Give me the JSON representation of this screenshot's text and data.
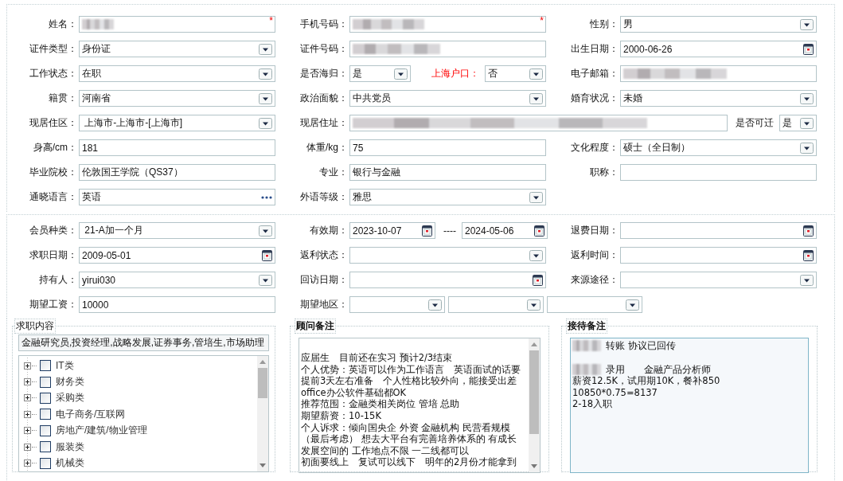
{
  "sections": [
    {
      "rows": [
        [
          {
            "label": "姓名：",
            "items": [
              {
                "kind": "masked",
                "required_mark": "*"
              }
            ]
          },
          {
            "label": "手机号码：",
            "items": [
              {
                "kind": "masked",
                "required_mark": "*"
              }
            ]
          },
          {
            "label": "性别：",
            "items": [
              {
                "kind": "select",
                "value": "男"
              }
            ]
          }
        ],
        [
          {
            "label": "证件类型：",
            "items": [
              {
                "kind": "select",
                "value": "身份证"
              }
            ]
          },
          {
            "label": "证件号码：",
            "items": [
              {
                "kind": "masked"
              }
            ]
          },
          {
            "label": "出生日期：",
            "items": [
              {
                "kind": "date",
                "value": "2000-06-26"
              }
            ]
          }
        ],
        [
          {
            "label": "工作状态：",
            "items": [
              {
                "kind": "select",
                "value": "在职"
              }
            ]
          },
          {
            "label": "是否海归：",
            "items": [
              {
                "kind": "select",
                "value": "是"
              },
              {
                "kind": "label",
                "text": "上海户口：",
                "emphasis": true
              },
              {
                "kind": "select",
                "value": "否"
              }
            ]
          },
          {
            "label": "电子邮箱：",
            "items": [
              {
                "kind": "masked"
              }
            ]
          }
        ],
        [
          {
            "label": "籍贯：",
            "items": [
              {
                "kind": "select",
                "value": "河南省"
              }
            ]
          },
          {
            "label": "政治面貌：",
            "items": [
              {
                "kind": "select",
                "value": "中共党员"
              }
            ]
          },
          {
            "label": "婚育状况：",
            "items": [
              {
                "kind": "select",
                "value": "未婚"
              }
            ]
          }
        ],
        [
          {
            "label": "现居住区：",
            "items": [
              {
                "kind": "select",
                "value": " 上海市-上海市-[上海市]"
              }
            ]
          },
          {
            "label": "现居住址：",
            "items": [
              {
                "kind": "masked"
              },
              {
                "kind": "label",
                "text": "是否可迁",
                "emphasis": false
              },
              {
                "kind": "select",
                "value": "是"
              }
            ]
          }
        ],
        [
          {
            "label": "身高/cm：",
            "items": [
              {
                "kind": "text",
                "value": "181"
              }
            ]
          },
          {
            "label": "体重/kg：",
            "items": [
              {
                "kind": "text",
                "value": "75"
              }
            ]
          },
          {
            "label": "文化程度：",
            "items": [
              {
                "kind": "select",
                "value": "硕士（全日制）"
              }
            ]
          }
        ],
        [
          {
            "label": "毕业院校：",
            "items": [
              {
                "kind": "text",
                "value": "伦敦国王学院（QS37）"
              }
            ]
          },
          {
            "label": "专业：",
            "items": [
              {
                "kind": "text",
                "value": "银行与金融"
              }
            ]
          },
          {
            "label": "职称：",
            "items": [
              {
                "kind": "text"
              }
            ]
          }
        ],
        [
          {
            "label": "通晓语言：",
            "items": [
              {
                "kind": "more",
                "value": "英语"
              }
            ]
          },
          {
            "label": "外语等级：",
            "items": [
              {
                "kind": "select",
                "value": "雅思"
              }
            ]
          }
        ]
      ]
    },
    {
      "rows": [
        [
          {
            "label": "会员种类：",
            "items": [
              {
                "kind": "select",
                "value": " 21-A加一个月"
              }
            ]
          },
          {
            "label": "有效期：",
            "items": [
              {
                "kind": "date",
                "value": "2023-10-07"
              },
              {
                "kind": "label",
                "text": "----",
                "emphasis": false
              },
              {
                "kind": "date",
                "value": "2024-05-06"
              }
            ]
          },
          {
            "label": "退费日期：",
            "items": [
              {
                "kind": "date"
              }
            ]
          }
        ],
        [
          {
            "label": "求职日期：",
            "items": [
              {
                "kind": "date",
                "value": "2009-05-01"
              }
            ]
          },
          {
            "label": "返利状态：",
            "items": [
              {
                "kind": "select"
              }
            ]
          },
          {
            "label": "返利时间：",
            "items": [
              {
                "kind": "date"
              }
            ]
          }
        ],
        [
          {
            "label": "持有人：",
            "items": [
              {
                "kind": "select",
                "value": "yirui030"
              }
            ]
          },
          {
            "label": "回访日期：",
            "items": [
              {
                "kind": "date"
              }
            ]
          },
          {
            "label": "来源途径：",
            "items": [
              {
                "kind": "select"
              }
            ]
          }
        ],
        [
          {
            "label": "期望工资：",
            "items": [
              {
                "kind": "text",
                "value": "10000"
              }
            ]
          },
          {
            "label": "期望地区：",
            "items": [
              {
                "kind": "select"
              },
              {
                "kind": "select"
              },
              {
                "kind": "select"
              }
            ]
          }
        ]
      ]
    }
  ],
  "panels": [
    {
      "kind": "tree",
      "title": "求职内容",
      "summary": "金融研究员,投资经理,战略发展,证券事务,管培生,市场助理",
      "scrollable": true,
      "items": [
        {
          "label": "IT类",
          "checked": false,
          "expanded": false
        },
        {
          "label": "财务类",
          "checked": false,
          "expanded": false
        },
        {
          "label": "采购类",
          "checked": false,
          "expanded": false
        },
        {
          "label": "电子商务/互联网",
          "checked": false,
          "expanded": false
        },
        {
          "label": "房地产/建筑/物业管理",
          "checked": false,
          "expanded": false
        },
        {
          "label": "服装类",
          "checked": false,
          "expanded": false
        },
        {
          "label": "机械类",
          "checked": false,
          "expanded": false
        }
      ]
    },
    {
      "kind": "note",
      "title": "顾问备注",
      "focused": false,
      "scrollable": true,
      "lines": [
        {
          "text": "应届生　目前还在实习 预计2/3结束",
          "spaced": true
        },
        {
          "text": "个人优势：英语可以作为工作语言　英语面试的话要"
        },
        {
          "text": "提前3天左右准备　个人性格比较外向，能接受出差"
        },
        {
          "text": "office办公软件基础都OK"
        },
        {
          "text": "推荐范围：金融类相关岗位 管培 总助"
        },
        {
          "text": "期望薪资：10-15K"
        },
        {
          "text": "个人诉求：倾向国央企 外资 金融机构 民营看规模"
        },
        {
          "text": "（最后考虑） 想去大平台有完善培养体系的 有成长"
        },
        {
          "text": "发展空间的 工作地点不限 一二线都可以"
        },
        {
          "text": "初面要线上　复试可以线下　明年的2月份才能拿到"
        }
      ]
    },
    {
      "kind": "note",
      "title": "接待备注",
      "focused": true,
      "lines": [
        {
          "text": "转账 协议已回传",
          "masked": true
        },
        {
          "text": "录用　　金融产品分析师",
          "masked": true,
          "spaced": true
        },
        {
          "text": "薪资12.5K，试用期10K，餐补850"
        },
        {
          "text": "10850*0.75=8137"
        },
        {
          "text": "2-18入职"
        }
      ]
    }
  ]
}
